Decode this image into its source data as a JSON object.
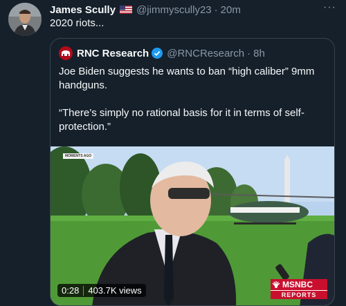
{
  "tweet": {
    "author_name": "James Scully",
    "flag_icon": "us-flag-icon",
    "handle": "@jimmyscully23",
    "time": "20m",
    "text": "2020 riots..."
  },
  "quoted": {
    "author_name": "RNC Research",
    "handle": "@RNCResearch",
    "time": "8h",
    "paragraphs": [
      "Joe Biden suggests he wants to ban “high caliber” 9mm handguns.",
      "“There’s simply no rational basis for it in terms of self-protection.”"
    ],
    "video": {
      "badge": "MOMENTS AGO",
      "duration": "0:28",
      "views": "403.7K views",
      "network_top": "MSNBC",
      "network_bottom": "REPORTS"
    }
  },
  "colors": {
    "background": "#15202b",
    "muted": "#8b98a5",
    "verified": "#1d9bf0",
    "brand_red": "#c8102e"
  }
}
